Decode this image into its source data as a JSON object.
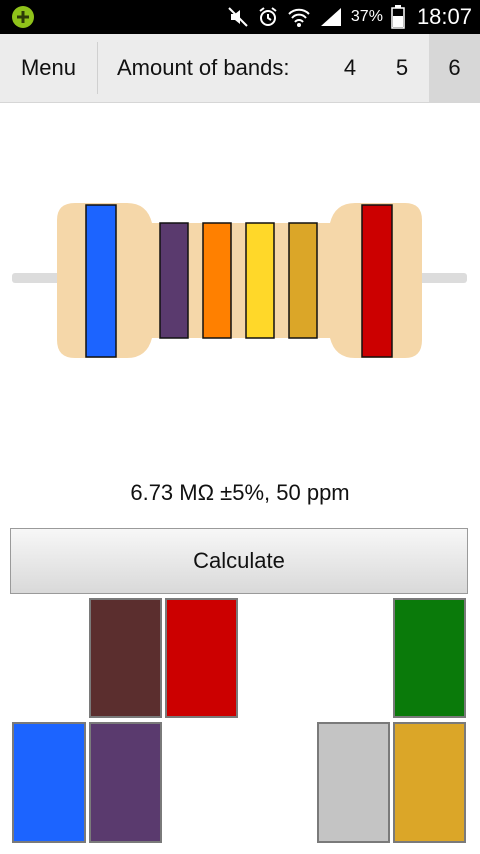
{
  "status_bar": {
    "battery": "37%",
    "time": "18:07",
    "icons": [
      "app-notification-icon",
      "mute-icon",
      "alarm-icon",
      "wifi-icon",
      "signal-icon",
      "battery-icon"
    ]
  },
  "toolbar": {
    "menu_label": "Menu",
    "bands_label": "Amount of bands:",
    "band_options": [
      "4",
      "5",
      "6"
    ],
    "selected": "6"
  },
  "resistor": {
    "body_color": "#f5d7a9",
    "bands": [
      {
        "name": "blue",
        "color": "#1c64ff"
      },
      {
        "name": "violet",
        "color": "#5a3a6e"
      },
      {
        "name": "orange",
        "color": "#ff8000"
      },
      {
        "name": "yellow",
        "color": "#ffd829"
      },
      {
        "name": "gold",
        "color": "#dba628"
      },
      {
        "name": "red",
        "color": "#cc0000"
      }
    ]
  },
  "result_text": "6.73 MΩ ±5%, 50 ppm",
  "calculate_label": "Calculate",
  "palette": [
    {
      "name": "brown",
      "color": "#5b2e2e"
    },
    {
      "name": "red",
      "color": "#cc0000"
    },
    {
      "name": "green",
      "color": "#0a7a0a"
    },
    {
      "name": "blue",
      "color": "#1c64ff"
    },
    {
      "name": "violet",
      "color": "#5a3a6e"
    },
    {
      "name": "grey",
      "color": "#c4c4c4"
    },
    {
      "name": "gold",
      "color": "#dba628"
    }
  ]
}
